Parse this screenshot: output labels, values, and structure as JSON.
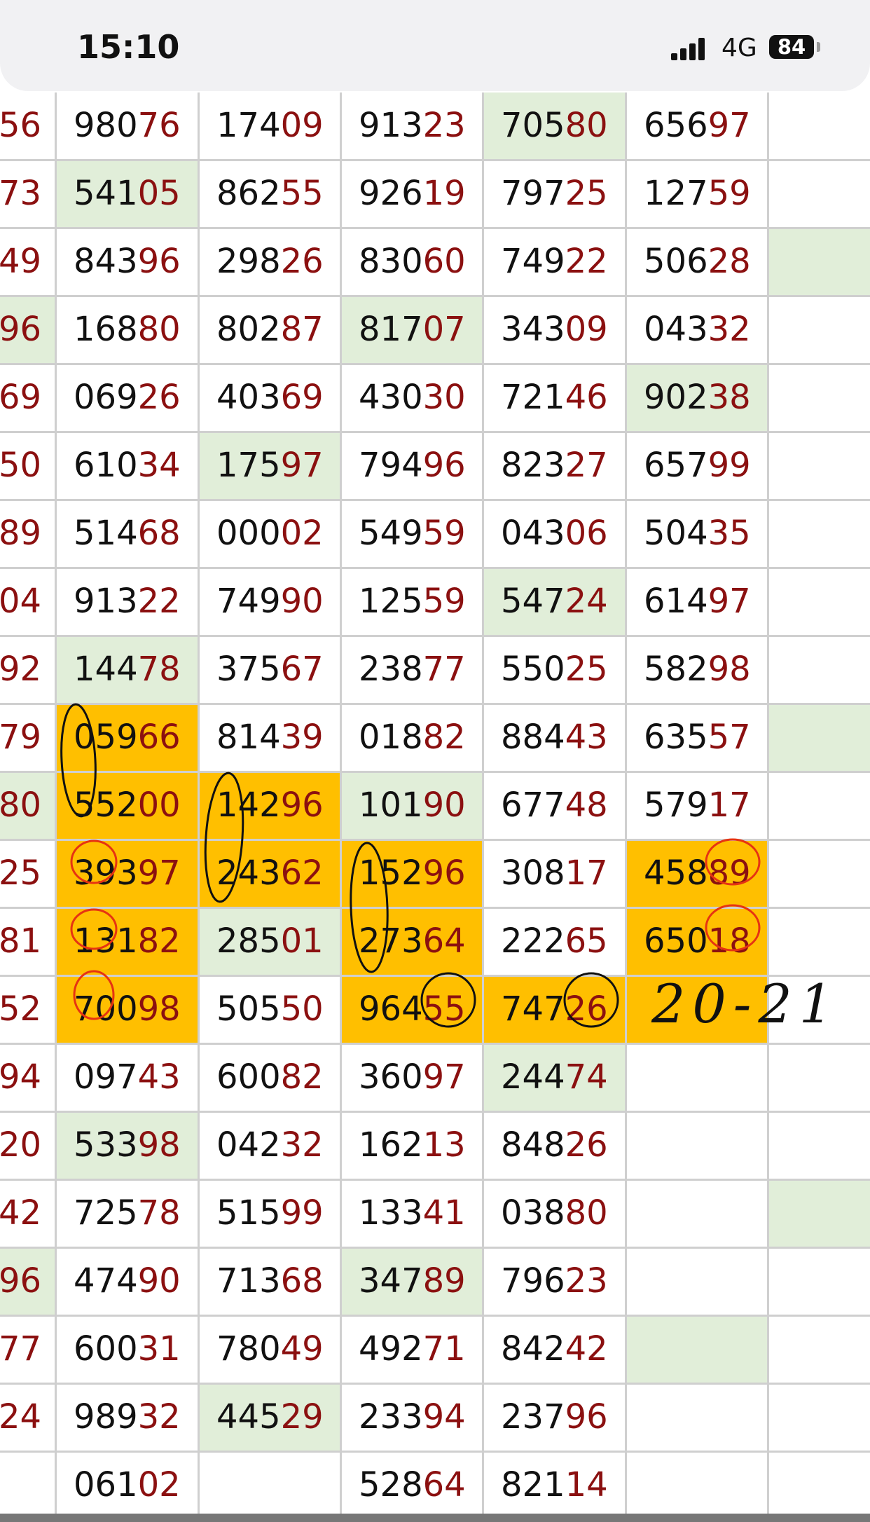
{
  "status_bar": {
    "time": "15:10",
    "network": "4G",
    "battery": "84"
  },
  "colors": {
    "green_highlight": "#e1eed9",
    "orange_highlight": "#ffbf00",
    "tail_digits": "#8b1010"
  },
  "handwritten_note": "20-21",
  "rows": [
    {
      "left": "56",
      "cells": [
        {
          "v": "98076"
        },
        {
          "v": "17409"
        },
        {
          "v": "91323"
        },
        {
          "v": "70580",
          "hl": "green"
        },
        {
          "v": "65697"
        },
        {
          "v": ""
        }
      ]
    },
    {
      "left": "73",
      "cells": [
        {
          "v": "54105",
          "hl": "green"
        },
        {
          "v": "86255"
        },
        {
          "v": "92619"
        },
        {
          "v": "79725"
        },
        {
          "v": "12759"
        },
        {
          "v": ""
        }
      ]
    },
    {
      "left": "49",
      "cells": [
        {
          "v": "84396"
        },
        {
          "v": "29826"
        },
        {
          "v": "83060"
        },
        {
          "v": "74922"
        },
        {
          "v": "50628"
        },
        {
          "v": "",
          "hl": "green"
        }
      ]
    },
    {
      "left": "96",
      "left_hl": "green",
      "cells": [
        {
          "v": "16880"
        },
        {
          "v": "80287"
        },
        {
          "v": "81707",
          "hl": "green"
        },
        {
          "v": "34309"
        },
        {
          "v": "04332"
        },
        {
          "v": ""
        }
      ]
    },
    {
      "left": "69",
      "cells": [
        {
          "v": "06926"
        },
        {
          "v": "40369"
        },
        {
          "v": "43030"
        },
        {
          "v": "72146"
        },
        {
          "v": "90238",
          "hl": "green"
        },
        {
          "v": ""
        }
      ]
    },
    {
      "left": "50",
      "cells": [
        {
          "v": "61034"
        },
        {
          "v": "17597",
          "hl": "green"
        },
        {
          "v": "79496"
        },
        {
          "v": "82327"
        },
        {
          "v": "65799"
        },
        {
          "v": ""
        }
      ]
    },
    {
      "left": "89",
      "cells": [
        {
          "v": "51468"
        },
        {
          "v": "00002"
        },
        {
          "v": "54959"
        },
        {
          "v": "04306"
        },
        {
          "v": "50435"
        },
        {
          "v": ""
        }
      ]
    },
    {
      "left": "04",
      "cells": [
        {
          "v": "91322"
        },
        {
          "v": "74990"
        },
        {
          "v": "12559"
        },
        {
          "v": "54724",
          "hl": "green"
        },
        {
          "v": "61497"
        },
        {
          "v": ""
        }
      ]
    },
    {
      "left": "92",
      "cells": [
        {
          "v": "14478",
          "hl": "green"
        },
        {
          "v": "37567"
        },
        {
          "v": "23877"
        },
        {
          "v": "55025"
        },
        {
          "v": "58298"
        },
        {
          "v": ""
        }
      ]
    },
    {
      "left": "79",
      "cells": [
        {
          "v": "05966",
          "hl": "orange"
        },
        {
          "v": "81439"
        },
        {
          "v": "01882"
        },
        {
          "v": "88443"
        },
        {
          "v": "63557"
        },
        {
          "v": "",
          "hl": "green"
        }
      ]
    },
    {
      "left": "80",
      "left_hl": "green",
      "cells": [
        {
          "v": "55200",
          "hl": "orange"
        },
        {
          "v": "14296",
          "hl": "orange"
        },
        {
          "v": "10190",
          "hl": "green"
        },
        {
          "v": "67748"
        },
        {
          "v": "57917"
        },
        {
          "v": ""
        }
      ]
    },
    {
      "left": "25",
      "cells": [
        {
          "v": "39397",
          "hl": "orange"
        },
        {
          "v": "24362",
          "hl": "orange"
        },
        {
          "v": "15296",
          "hl": "orange"
        },
        {
          "v": "30817"
        },
        {
          "v": "45889",
          "hl": "orange"
        },
        {
          "v": ""
        }
      ]
    },
    {
      "left": "81",
      "cells": [
        {
          "v": "13182",
          "hl": "orange"
        },
        {
          "v": "28501",
          "hl": "green"
        },
        {
          "v": "27364",
          "hl": "orange"
        },
        {
          "v": "22265"
        },
        {
          "v": "65018",
          "hl": "orange"
        },
        {
          "v": ""
        }
      ]
    },
    {
      "left": "52",
      "cells": [
        {
          "v": "70098",
          "hl": "orange"
        },
        {
          "v": "50550"
        },
        {
          "v": "96455",
          "hl": "orange"
        },
        {
          "v": "74726",
          "hl": "orange"
        },
        {
          "v": "",
          "hl": "orange"
        },
        {
          "v": ""
        }
      ]
    },
    {
      "left": "94",
      "cells": [
        {
          "v": "09743"
        },
        {
          "v": "60082"
        },
        {
          "v": "36097"
        },
        {
          "v": "24474",
          "hl": "green"
        },
        {
          "v": ""
        },
        {
          "v": ""
        }
      ]
    },
    {
      "left": "20",
      "cells": [
        {
          "v": "53398",
          "hl": "green"
        },
        {
          "v": "04232"
        },
        {
          "v": "16213"
        },
        {
          "v": "84826"
        },
        {
          "v": ""
        },
        {
          "v": ""
        }
      ]
    },
    {
      "left": "42",
      "cells": [
        {
          "v": "72578"
        },
        {
          "v": "51599"
        },
        {
          "v": "13341"
        },
        {
          "v": "03880"
        },
        {
          "v": ""
        },
        {
          "v": "",
          "hl": "green"
        }
      ]
    },
    {
      "left": "96",
      "left_hl": "green",
      "cells": [
        {
          "v": "47490"
        },
        {
          "v": "71368"
        },
        {
          "v": "34789",
          "hl": "green"
        },
        {
          "v": "79623"
        },
        {
          "v": ""
        },
        {
          "v": ""
        }
      ]
    },
    {
      "left": "77",
      "cells": [
        {
          "v": "60031"
        },
        {
          "v": "78049"
        },
        {
          "v": "49271"
        },
        {
          "v": "84242"
        },
        {
          "v": "",
          "hl": "green"
        },
        {
          "v": ""
        }
      ]
    },
    {
      "left": "24",
      "cells": [
        {
          "v": "98932"
        },
        {
          "v": "44529",
          "hl": "green"
        },
        {
          "v": "23394"
        },
        {
          "v": "23796"
        },
        {
          "v": ""
        },
        {
          "v": ""
        }
      ]
    },
    {
      "left": "",
      "cells": [
        {
          "v": "06102"
        },
        {
          "v": ""
        },
        {
          "v": "52864"
        },
        {
          "v": "82114"
        },
        {
          "v": ""
        },
        {
          "v": ""
        }
      ]
    }
  ]
}
